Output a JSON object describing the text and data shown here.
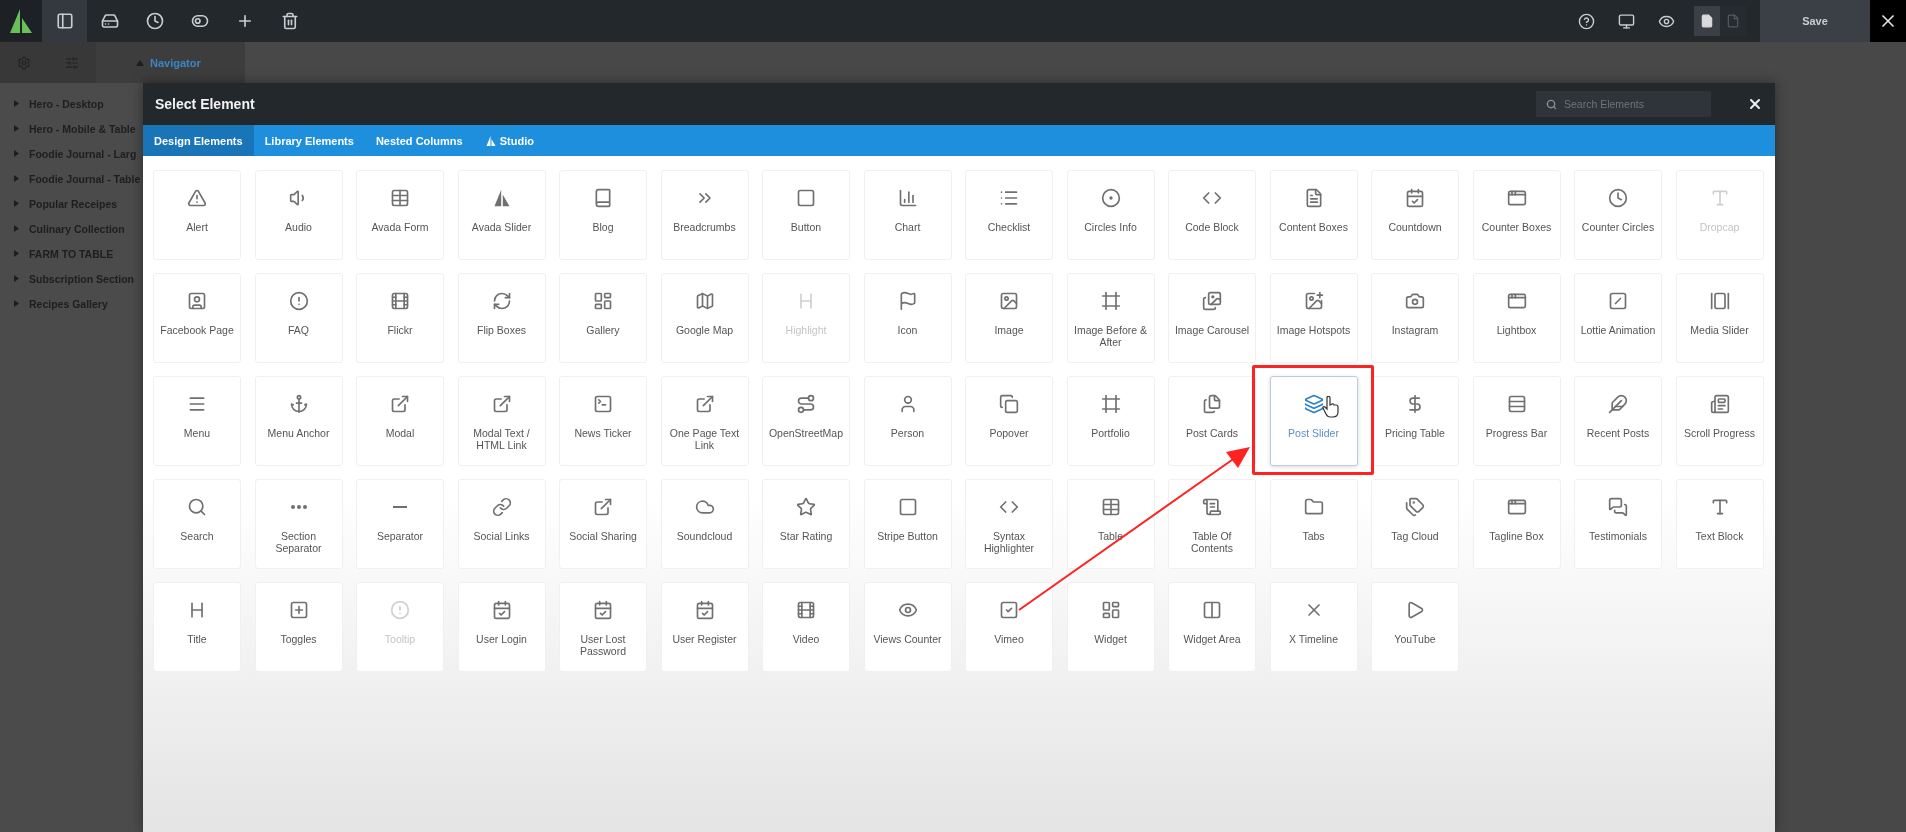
{
  "toolbar": {
    "tools": [
      {
        "selected": true
      },
      {
        "selected": false
      },
      {
        "selected": false
      },
      {
        "selected": false
      },
      {
        "selected": false
      },
      {
        "selected": false
      }
    ],
    "view_modes": [
      {
        "selected": true
      },
      {
        "selected": false
      }
    ],
    "save_button": "Save"
  },
  "sidebar": {
    "panel_title": "Navigator",
    "items": [
      {
        "label": "Hero - Desktop"
      },
      {
        "label": "Hero - Mobile & Table"
      },
      {
        "label": "Foodie Journal - Larg"
      },
      {
        "label": "Foodie Journal - Table"
      },
      {
        "label": "Popular Receipes"
      },
      {
        "label": "Culinary Collection"
      },
      {
        "label": "FARM TO TABLE"
      },
      {
        "label": "Subscription Section"
      },
      {
        "label": "Recipes Gallery"
      }
    ]
  },
  "dialog": {
    "title": "Select Element",
    "search": {
      "placeholder": "Search Elements"
    },
    "tabs": [
      {
        "label": "Design Elements",
        "selected": true
      },
      {
        "label": "Library Elements",
        "selected": false
      },
      {
        "label": "Nested Columns",
        "selected": false
      },
      {
        "label": "Studio",
        "selected": false
      }
    ],
    "elements": [
      {
        "label": "Alert",
        "disabled": false,
        "selected": false
      },
      {
        "label": "Audio",
        "disabled": false,
        "selected": false
      },
      {
        "label": "Avada Form",
        "disabled": false,
        "selected": false
      },
      {
        "label": "Avada Slider",
        "disabled": false,
        "selected": false
      },
      {
        "label": "Blog",
        "disabled": false,
        "selected": false
      },
      {
        "label": "Breadcrumbs",
        "disabled": false,
        "selected": false
      },
      {
        "label": "Button",
        "disabled": false,
        "selected": false
      },
      {
        "label": "Chart",
        "disabled": false,
        "selected": false
      },
      {
        "label": "Checklist",
        "disabled": false,
        "selected": false
      },
      {
        "label": "Circles Info",
        "disabled": false,
        "selected": false
      },
      {
        "label": "Code Block",
        "disabled": false,
        "selected": false
      },
      {
        "label": "Content Boxes",
        "disabled": false,
        "selected": false
      },
      {
        "label": "Countdown",
        "disabled": false,
        "selected": false
      },
      {
        "label": "Counter Boxes",
        "disabled": false,
        "selected": false
      },
      {
        "label": "Counter Circles",
        "disabled": false,
        "selected": false
      },
      {
        "label": "Dropcap",
        "disabled": true,
        "selected": false
      },
      {
        "label": "Facebook Page",
        "disabled": false,
        "selected": false
      },
      {
        "label": "FAQ",
        "disabled": false,
        "selected": false
      },
      {
        "label": "Flickr",
        "disabled": false,
        "selected": false
      },
      {
        "label": "Flip Boxes",
        "disabled": false,
        "selected": false
      },
      {
        "label": "Gallery",
        "disabled": false,
        "selected": false
      },
      {
        "label": "Google Map",
        "disabled": false,
        "selected": false
      },
      {
        "label": "Highlight",
        "disabled": true,
        "selected": false
      },
      {
        "label": "Icon",
        "disabled": false,
        "selected": false
      },
      {
        "label": "Image",
        "disabled": false,
        "selected": false
      },
      {
        "label": "Image Before & After",
        "disabled": false,
        "selected": false
      },
      {
        "label": "Image Carousel",
        "disabled": false,
        "selected": false
      },
      {
        "label": "Image Hotspots",
        "disabled": false,
        "selected": false
      },
      {
        "label": "Instagram",
        "disabled": false,
        "selected": false
      },
      {
        "label": "Lightbox",
        "disabled": false,
        "selected": false
      },
      {
        "label": "Lottie Animation",
        "disabled": false,
        "selected": false
      },
      {
        "label": "Media Slider",
        "disabled": false,
        "selected": false
      },
      {
        "label": "Menu",
        "disabled": false,
        "selected": false
      },
      {
        "label": "Menu Anchor",
        "disabled": false,
        "selected": false
      },
      {
        "label": "Modal",
        "disabled": false,
        "selected": false
      },
      {
        "label": "Modal Text / HTML Link",
        "disabled": false,
        "selected": false
      },
      {
        "label": "News Ticker",
        "disabled": false,
        "selected": false
      },
      {
        "label": "One Page Text Link",
        "disabled": false,
        "selected": false
      },
      {
        "label": "OpenStreetMap",
        "disabled": false,
        "selected": false
      },
      {
        "label": "Person",
        "disabled": false,
        "selected": false
      },
      {
        "label": "Popover",
        "disabled": false,
        "selected": false
      },
      {
        "label": "Portfolio",
        "disabled": false,
        "selected": false
      },
      {
        "label": "Post Cards",
        "disabled": false,
        "selected": false
      },
      {
        "label": "Post Slider",
        "disabled": false,
        "selected": true
      },
      {
        "label": "Pricing Table",
        "disabled": false,
        "selected": false
      },
      {
        "label": "Progress Bar",
        "disabled": false,
        "selected": false
      },
      {
        "label": "Recent Posts",
        "disabled": false,
        "selected": false
      },
      {
        "label": "Scroll Progress",
        "disabled": false,
        "selected": false
      },
      {
        "label": "Search",
        "disabled": false,
        "selected": false
      },
      {
        "label": "Section Separator",
        "disabled": false,
        "selected": false
      },
      {
        "label": "Separator",
        "disabled": false,
        "selected": false
      },
      {
        "label": "Social Links",
        "disabled": false,
        "selected": false
      },
      {
        "label": "Social Sharing",
        "disabled": false,
        "selected": false
      },
      {
        "label": "Soundcloud",
        "disabled": false,
        "selected": false
      },
      {
        "label": "Star Rating",
        "disabled": false,
        "selected": false
      },
      {
        "label": "Stripe Button",
        "disabled": false,
        "selected": false
      },
      {
        "label": "Syntax Highlighter",
        "disabled": false,
        "selected": false
      },
      {
        "label": "Table",
        "disabled": false,
        "selected": false
      },
      {
        "label": "Table Of Contents",
        "disabled": false,
        "selected": false
      },
      {
        "label": "Tabs",
        "disabled": false,
        "selected": false
      },
      {
        "label": "Tag Cloud",
        "disabled": false,
        "selected": false
      },
      {
        "label": "Tagline Box",
        "disabled": false,
        "selected": false
      },
      {
        "label": "Testimonials",
        "disabled": false,
        "selected": false
      },
      {
        "label": "Text Block",
        "disabled": false,
        "selected": false
      },
      {
        "label": "Title",
        "disabled": false,
        "selected": false
      },
      {
        "label": "Toggles",
        "disabled": false,
        "selected": false
      },
      {
        "label": "Tooltip",
        "disabled": true,
        "selected": false
      },
      {
        "label": "User Login",
        "disabled": false,
        "selected": false
      },
      {
        "label": "User Lost Password",
        "disabled": false,
        "selected": false
      },
      {
        "label": "User Register",
        "disabled": false,
        "selected": false
      },
      {
        "label": "Video",
        "disabled": false,
        "selected": false
      },
      {
        "label": "Views Counter",
        "disabled": false,
        "selected": false
      },
      {
        "label": "Vimeo",
        "disabled": false,
        "selected": false
      },
      {
        "label": "Widget",
        "disabled": false,
        "selected": false
      },
      {
        "label": "Widget Area",
        "disabled": false,
        "selected": false
      },
      {
        "label": "X Timeline",
        "disabled": false,
        "selected": false
      },
      {
        "label": "YouTube",
        "disabled": false,
        "selected": false
      }
    ]
  }
}
